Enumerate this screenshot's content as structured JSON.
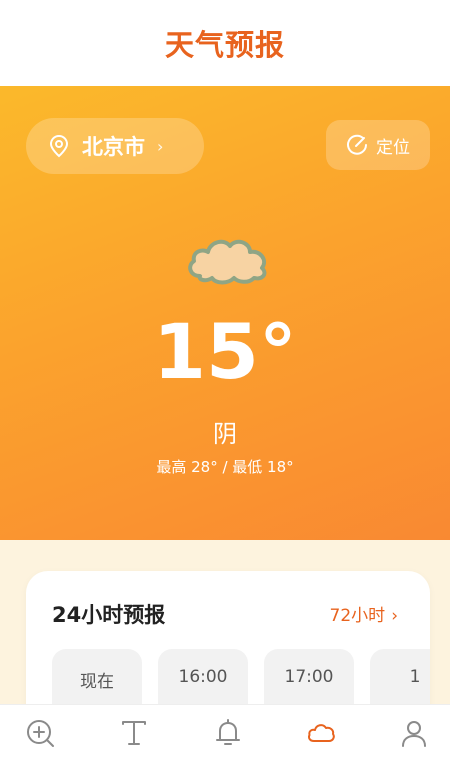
{
  "header": {
    "title": "天气预报"
  },
  "location": {
    "city": "北京市",
    "chevron": "›",
    "locate_label": "定位"
  },
  "weather": {
    "temperature": "15°",
    "condition": "阴",
    "range": "最高 28° / 最低 18°",
    "icon": "cloud-icon"
  },
  "forecast": {
    "title": "24小时预报",
    "link_label": "72小时",
    "link_chevron": "›",
    "hours": [
      "现在",
      "16:00",
      "17:00",
      "1"
    ]
  },
  "bottom_nav": {
    "items": [
      {
        "icon": "add-search-icon"
      },
      {
        "icon": "text-icon"
      },
      {
        "icon": "bell-icon"
      },
      {
        "icon": "cloud-icon",
        "active": true
      },
      {
        "icon": "user-icon"
      }
    ]
  },
  "colors": {
    "accent": "#e8631e",
    "hero_start": "#fbb92b",
    "hero_end": "#f98932",
    "nav_inactive": "#8a8a8a"
  }
}
